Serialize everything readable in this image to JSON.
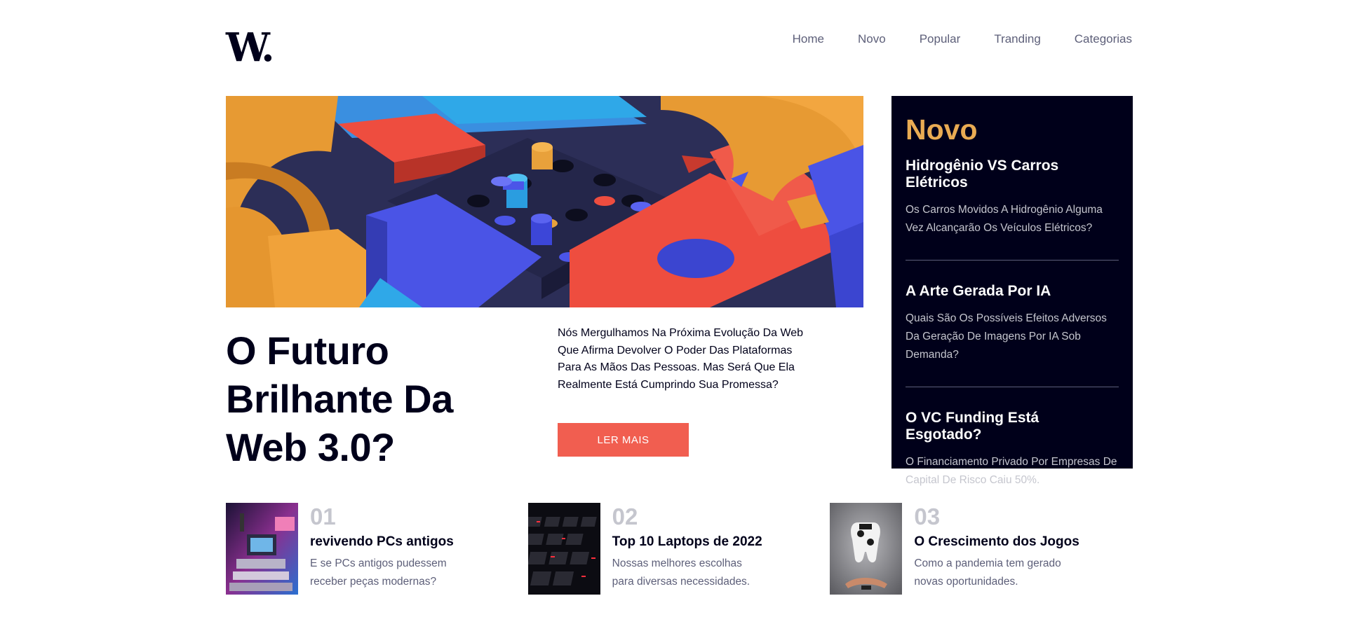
{
  "header": {
    "logo": "W",
    "logo_dot": ".",
    "nav": [
      "Home",
      "Novo",
      "Popular",
      "Tranding",
      "Categorias"
    ]
  },
  "hero": {
    "title": "O Futuro Brilhante Da Web 3.0?",
    "description": "Nós Mergulhamos Na Próxima Evolução Da Web Que Afirma Devolver O Poder Das Plataformas Para As Mãos Das Pessoas. Mas Será Que Ela Realmente Está Cumprindo Sua Promessa?",
    "button_label": "LER MAIS"
  },
  "sidebar": {
    "title": "Novo",
    "items": [
      {
        "title": "Hidrogênio VS Carros Elétricos",
        "text": "Os Carros Movidos A Hidrogênio Alguma Vez Alcançarão Os Veículos Elétricos?"
      },
      {
        "title": "A Arte Gerada Por IA",
        "text": "Quais São Os Possíveis Efeitos Adversos Da Geração De Imagens Por IA Sob Demanda?"
      },
      {
        "title": "O VC Funding Está Esgotado?",
        "text": "O Financiamento Privado Por Empresas De Capital De Risco Caiu 50%."
      }
    ]
  },
  "cards": [
    {
      "num": "01",
      "title": "revivendo PCs antigos",
      "text": "E se PCs antigos pudessem receber peças modernas?"
    },
    {
      "num": "02",
      "title": "Top 10 Laptops de 2022",
      "text": "Nossas melhores escolhas para diversas necessidades."
    },
    {
      "num": "03",
      "title": "O Crescimento dos Jogos",
      "text": "Como a pandemia tem gerado novas oportunidades."
    }
  ],
  "colors": {
    "accent": "#f15e50",
    "sidebar_bg": "#00001a",
    "sidebar_title": "#e9ab53",
    "muted": "#5d5f79",
    "number": "#c5c6ce"
  }
}
